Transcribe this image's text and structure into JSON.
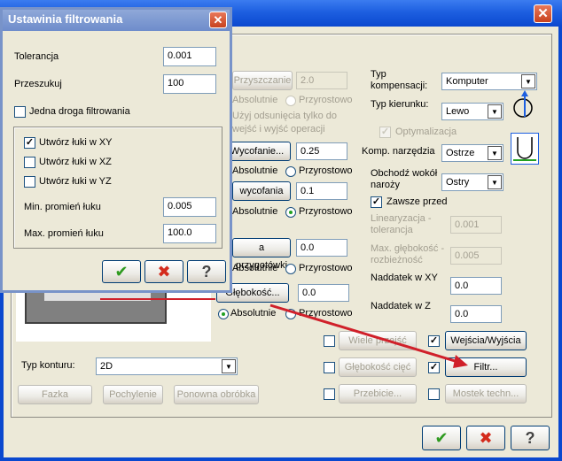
{
  "main": {
    "close": "✕",
    "compensation": {
      "type_label": "Typ kompensacji:",
      "type_value": "Komputer",
      "direction_label": "Typ kierunku:",
      "direction_value": "Lewo",
      "optimization_label": "Optymalizacja",
      "corner_label": "Komp. narzędzia",
      "corner_value": "Ostrze",
      "go_around_label": "Obchodź wokół naroży",
      "go_around_value": "Ostry",
      "always_before_label": "Zawsze przed",
      "linearization_label": "Linearyzacja - tolerancja",
      "linearization_value": "0.001",
      "max_depth_label": "Max. głębokość - rozbieżność",
      "max_depth_value": "0.005",
      "stock_xy_label": "Naddatek w XY",
      "stock_xy_value": "0.0",
      "stock_z_label": "Naddatek w Z",
      "stock_z_value": "0.0"
    },
    "mid": {
      "clearance_button": "Przyszczanie",
      "clearance_value": "2.0",
      "absolute": "Absolutnie",
      "incremental": "Przyrostowo",
      "note": "Użyj odsunięcia tylko do wejść i wyjść operacji",
      "retract_button": "Wycofanie...",
      "retract_value": "0.25",
      "feed_plane_button": "wycofania",
      "feed_plane_value": "0.1",
      "top_stock_button": "a przygotówki",
      "top_stock_value": "0.0",
      "depth_button": "Głębokość...",
      "depth_value": "0.0"
    },
    "contour_type_label": "Typ konturu:",
    "contour_type_value": "2D",
    "bottom_buttons": [
      "Fazka",
      "Pochylenie",
      "Ponowna obróbka"
    ],
    "right_options": [
      {
        "label": "Wiele przejść",
        "checked": false,
        "disabled": true
      },
      {
        "label": "Wejścia/Wyjścia",
        "checked": true,
        "disabled": false
      },
      {
        "label": "Głębokość cięć",
        "checked": false,
        "disabled": true
      },
      {
        "label": "Filtr...",
        "checked": true,
        "disabled": false
      },
      {
        "label": "Przebicie...",
        "checked": false,
        "disabled": true
      },
      {
        "label": "Mostek techn...",
        "checked": false,
        "disabled": true
      }
    ],
    "ok": "✔",
    "cancel": "✖",
    "help": "?"
  },
  "filter": {
    "title": "Ustawinia filtrowania",
    "close": "✕",
    "tolerance_label": "Tolerancja",
    "tolerance_value": "0.001",
    "lookahead_label": "Przeszukuj",
    "lookahead_value": "100",
    "one_way_label": "Jedna droga filtrowania",
    "arcs_xy_label": "Utwórz łuki w XY",
    "arcs_xz_label": "Utwórz łuki w XZ",
    "arcs_yz_label": "Utwórz łuki w YZ",
    "min_radius_label": "Min. promień łuku",
    "min_radius_value": "0.005",
    "max_radius_label": "Max. promień łuku",
    "max_radius_value": "100.0",
    "check_mark": "✓",
    "ok": "✔",
    "cancel": "✖",
    "help": "?"
  },
  "colors": {
    "accent": "#0B48CF",
    "arrow": "#D0202A",
    "ok_green": "#2E9A1F",
    "cancel_red": "#D42B1C"
  }
}
